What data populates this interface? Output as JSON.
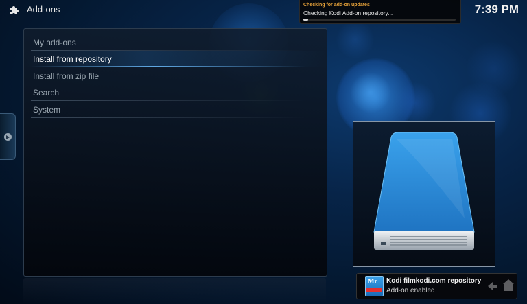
{
  "header": {
    "title": "Add-ons",
    "clock": "7:39 PM",
    "icon": "puzzle-icon"
  },
  "progress_notification": {
    "title": "Checking for add-on updates",
    "message": "Checking Kodi Add-on repository...",
    "progress": 0.03
  },
  "menu": {
    "items": [
      {
        "label": "My add-ons",
        "focused": false
      },
      {
        "label": "Install from repository",
        "focused": true
      },
      {
        "label": "Install from zip file",
        "focused": false
      },
      {
        "label": "Search",
        "focused": false
      },
      {
        "label": "System",
        "focused": false
      }
    ]
  },
  "preview": {
    "icon": "hard-drive-icon"
  },
  "toast": {
    "logo_text": "Mr",
    "title": "Kodi filmkodi.com repository",
    "message": "Add-on enabled"
  },
  "colors": {
    "accent": "#4aa8f0",
    "notification_title": "#e8a33a",
    "drive_blue": "#2a8ad8"
  }
}
